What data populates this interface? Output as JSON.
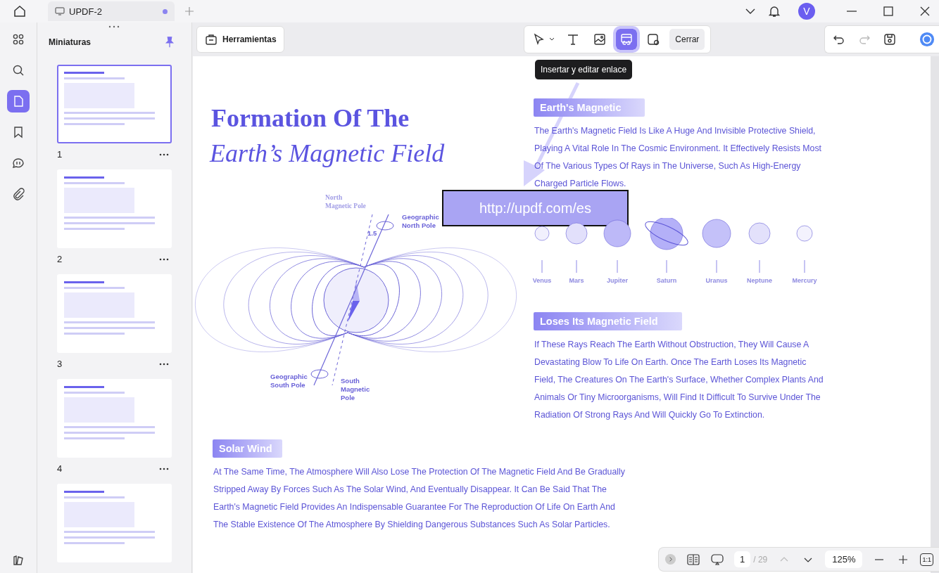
{
  "tab": {
    "title": "UPDF-2",
    "modified": true
  },
  "account": {
    "initial": "V"
  },
  "rail": [
    {
      "kind": "apps",
      "selected": false
    },
    {
      "kind": "search",
      "selected": false
    },
    {
      "kind": "pages",
      "selected": true
    },
    {
      "kind": "bookmark",
      "selected": false
    },
    {
      "kind": "comment",
      "selected": false
    },
    {
      "kind": "attachment",
      "selected": false
    }
  ],
  "thumbnails_panel": {
    "title": "Miniaturas",
    "pinned": true
  },
  "thumbnails": [
    {
      "label": "1",
      "selected": true
    },
    {
      "label": "2",
      "selected": false
    },
    {
      "label": "3",
      "selected": false
    },
    {
      "label": "4",
      "selected": false
    },
    {
      "selected": false
    }
  ],
  "tools_button": "Herramientas",
  "edit_tools": [
    {
      "kind": "select",
      "selected": false
    },
    {
      "kind": "text",
      "selected": false
    },
    {
      "kind": "image",
      "selected": false
    },
    {
      "kind": "link",
      "selected": true
    },
    {
      "kind": "link-location",
      "selected": false
    }
  ],
  "close_button": "Cerrar",
  "tooltip": "Insertar y editar enlace",
  "document": {
    "title_line1": "Formation Of The",
    "title_line2": "Earth’s Magnetic Field",
    "diagram_labels": [
      "North",
      "Magnetic Pole",
      "Geographic",
      "North Pole",
      "1.5",
      "Geographic",
      "South Pole",
      "South",
      "Magnetic",
      "Pole"
    ],
    "sections": [
      {
        "heading": "Earth's Magnetic",
        "lines": [
          "The Earth's Magnetic Field Is Like A Huge And Invisible Protective Shield,",
          "Playing A Vital Role In The Cosmic Environment. It Effectively Resists Most",
          "Of The Various Types Of Rays in The Universe, Such As High-Energy",
          "Charged Particle Flows."
        ]
      },
      {
        "heading": "Loses Its Magnetic Field",
        "lines": [
          "If These Rays Reach The Earth Without Obstruction, They Will Cause A",
          "Devastating Blow To Life On Earth. Once The Earth Loses Its Magnetic",
          "Field, The Creatures On The Earth's Surface, Whether Complex Plants And",
          "Animals Or Tiny Microorganisms, Will Find It Difficult To Survive Under The",
          "Radiation Of Strong Rays And Will Quickly Go To Extinction."
        ]
      },
      {
        "heading": "Solar Wind",
        "lines": [
          "At The Same Time, The Atmosphere Will Also Lose The Protection Of The Magnetic Field And Be Gradually",
          "Stripped Away By Forces Such As The Solar Wind, And Eventually Disappear. It Can Be Said That The",
          "Earth's Magnetic Field Provides An Indispensable Guarantee For The Reproduction Of Life On Earth And",
          "The Stable Existence Of The Atmosphere By Shielding Dangerous Substances Such As Solar Particles."
        ]
      }
    ],
    "planets": [
      {
        "name": "Venus",
        "color": "#f1f0fd",
        "ringed": false
      },
      {
        "name": "Mars",
        "color": "#e2e0fb",
        "ringed": false
      },
      {
        "name": "Jupiter",
        "color": "#bdb9f8",
        "ringed": false
      },
      {
        "name": "Saturn",
        "color": "#b4b0f8",
        "ringed": true
      },
      {
        "name": "Uranus",
        "color": "#c4c1f9",
        "ringed": false
      },
      {
        "name": "Neptune",
        "color": "#e3e1fb",
        "ringed": false
      },
      {
        "name": "Mercury",
        "color": "#f3f2fd",
        "ringed": false
      }
    ],
    "link_box": {
      "url": "http://updf.com/es"
    }
  },
  "page_nav": {
    "current": "1",
    "total": "/ 29",
    "zoom": "125%",
    "actual_size": "1:1"
  }
}
